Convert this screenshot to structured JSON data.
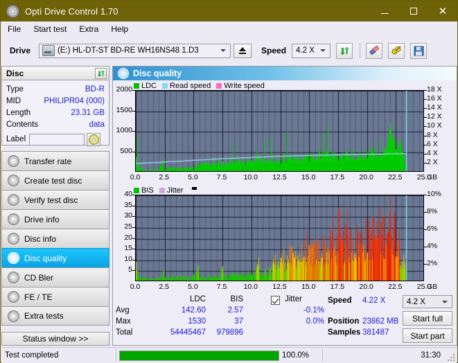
{
  "window": {
    "title": "Opti Drive Control 1.70",
    "icon": "disc-icon",
    "minimize_label": "─",
    "maximize_label": "□",
    "close_label": "✕"
  },
  "menu": {
    "items": [
      {
        "label": "File"
      },
      {
        "label": "Start test"
      },
      {
        "label": "Extra"
      },
      {
        "label": "Help"
      }
    ]
  },
  "toolbar": {
    "drive_label": "Drive",
    "drive_value": "(E:)  HL-DT-ST BD-RE  WH16NS48 1.D3",
    "eject_icon": "eject-icon",
    "speed_label": "Speed",
    "speed_value": "4.2 X",
    "refresh_icon": "refresh-icon",
    "erase_icon": "eraser-icon",
    "settings_icon": "plug-icon",
    "save_icon": "save-icon"
  },
  "disc_panel": {
    "title": "Disc",
    "refresh_icon": "refresh-icon",
    "rows": [
      {
        "key": "Type",
        "value": "BD-R"
      },
      {
        "key": "MID",
        "value": "PHILIPR04 (000)"
      },
      {
        "key": "Length",
        "value": "23.31 GB"
      },
      {
        "key": "Contents",
        "value": "data"
      }
    ],
    "label_key": "Label",
    "label_value": "",
    "label_placeholder": "",
    "label_button_icon": "disc-icon"
  },
  "sidebar": {
    "items": [
      {
        "label": "Transfer rate",
        "icon": "disc-icon",
        "active": false
      },
      {
        "label": "Create test disc",
        "icon": "disc-icon",
        "active": false
      },
      {
        "label": "Verify test disc",
        "icon": "disc-icon",
        "active": false
      },
      {
        "label": "Drive info",
        "icon": "disc-icon",
        "active": false
      },
      {
        "label": "Disc info",
        "icon": "disc-icon",
        "active": false
      },
      {
        "label": "Disc quality",
        "icon": "disc-icon",
        "active": true
      },
      {
        "label": "CD Bler",
        "icon": "disc-icon",
        "active": false
      },
      {
        "label": "FE / TE",
        "icon": "disc-icon",
        "active": false
      },
      {
        "label": "Extra tests",
        "icon": "disc-icon",
        "active": false
      }
    ],
    "status_window_label": "Status window >>"
  },
  "main": {
    "header_title": "Disc quality",
    "header_icon": "disc-quality-icon"
  },
  "chart_data": [
    {
      "type": "area",
      "name": "ldc-chart",
      "title": "",
      "xlabel": "GB",
      "ylabel": "",
      "xlim": [
        0,
        25
      ],
      "ylim": [
        0,
        2000
      ],
      "y2lim": [
        0,
        18
      ],
      "xticks": [
        "0.0",
        "2.5",
        "5.0",
        "7.5",
        "10.0",
        "12.5",
        "15.0",
        "17.5",
        "20.0",
        "22.5",
        "25.0"
      ],
      "yticks": [
        "500",
        "1000",
        "1500",
        "2000"
      ],
      "y2ticks": [
        "2 X",
        "4 X",
        "6 X",
        "8 X",
        "10 X",
        "12 X",
        "14 X",
        "16 X",
        "18 X"
      ],
      "x_unit": "GB",
      "grid": true,
      "legend_position": "top-left",
      "legend": [
        {
          "label": "LDC",
          "color": "#00c000"
        },
        {
          "label": "Read speed",
          "color": "#88d8f4"
        },
        {
          "label": "Write speed",
          "color": "#ff66cc"
        }
      ],
      "plot_bg": "#6b7894",
      "cursor_x": 23.4,
      "data_end_x": 23.4,
      "series": [
        {
          "name": "LDC",
          "color": "#00c000",
          "x": [
            0.0,
            0.15,
            0.3,
            0.5,
            0.8,
            1.0,
            1.3,
            1.6,
            2.0,
            2.3,
            2.45,
            2.6,
            3.0,
            3.2,
            3.5,
            3.8,
            4.1,
            4.4,
            4.7,
            5.0,
            5.2,
            5.4,
            5.6,
            5.8,
            6.0,
            6.3,
            6.6,
            6.9,
            7.2,
            7.5,
            7.8,
            8.1,
            8.4,
            8.7,
            9.0,
            9.3,
            9.6,
            9.9,
            10.2,
            10.5,
            10.8,
            11.1,
            11.4,
            11.7,
            12.0,
            12.3,
            12.6,
            12.9,
            13.2,
            13.5,
            13.8,
            14.1,
            14.4,
            14.7,
            15.0,
            15.3,
            15.6,
            15.9,
            16.2,
            16.5,
            16.8,
            17.1,
            17.4,
            17.7,
            18.0,
            18.3,
            18.6,
            18.9,
            19.2,
            19.5,
            19.8,
            20.1,
            20.4,
            20.7,
            21.0,
            21.3,
            21.6,
            21.9,
            22.0,
            22.1,
            22.2,
            22.4,
            22.6,
            22.8,
            23.0,
            23.2,
            23.35,
            23.4
          ],
          "values": [
            480,
            200,
            120,
            90,
            70,
            60,
            60,
            70,
            60,
            470,
            60,
            90,
            120,
            150,
            110,
            130,
            140,
            120,
            130,
            110,
            260,
            230,
            250,
            240,
            260,
            250,
            270,
            260,
            270,
            260,
            280,
            300,
            290,
            300,
            320,
            280,
            300,
            330,
            310,
            470,
            330,
            350,
            380,
            360,
            420,
            400,
            380,
            400,
            390,
            420,
            410,
            400,
            430,
            420,
            460,
            440,
            430,
            450,
            470,
            520,
            450,
            480,
            470,
            500,
            490,
            520,
            500,
            530,
            520,
            560,
            540,
            570,
            560,
            590,
            580,
            620,
            700,
            1100,
            1300,
            1000,
            900,
            860,
            820,
            760,
            700,
            500,
            200,
            0
          ]
        },
        {
          "name": "Read speed",
          "color": "#88d8f4",
          "unit": "X",
          "x": [
            0.0,
            1.0,
            2.0,
            3.0,
            4.0,
            5.0,
            6.0,
            7.0,
            8.0,
            9.0,
            10.0,
            11.0,
            12.0,
            13.0,
            14.0,
            15.0,
            16.0,
            17.0,
            18.0,
            19.0,
            20.0,
            21.0,
            22.0,
            23.0,
            23.4
          ],
          "values": [
            2.0,
            2.1,
            2.2,
            2.4,
            2.5,
            2.7,
            2.8,
            3.0,
            3.1,
            3.2,
            3.3,
            3.4,
            3.5,
            3.6,
            3.7,
            3.75,
            3.8,
            3.85,
            3.9,
            3.95,
            4.0,
            4.05,
            4.1,
            4.15,
            4.2
          ]
        },
        {
          "name": "Write speed",
          "color": "#ff66cc",
          "x": [],
          "values": []
        }
      ]
    },
    {
      "type": "area",
      "name": "bis-chart",
      "title": "",
      "xlabel": "GB",
      "ylabel": "",
      "xlim": [
        0,
        25
      ],
      "ylim": [
        0,
        40
      ],
      "y2lim": [
        0,
        10
      ],
      "xticks": [
        "0.0",
        "2.5",
        "5.0",
        "7.5",
        "10.0",
        "12.5",
        "15.0",
        "17.5",
        "20.0",
        "22.5",
        "25.0"
      ],
      "yticks": [
        "5",
        "10",
        "15",
        "20",
        "25",
        "30",
        "35",
        "40"
      ],
      "y2ticks": [
        "2%",
        "4%",
        "6%",
        "8%",
        "10%"
      ],
      "x_unit": "GB",
      "grid": true,
      "legend_position": "top-left",
      "legend": [
        {
          "label": "BIS",
          "color": "#00c000"
        },
        {
          "label": "Jitter",
          "color": "#cfa8d8"
        }
      ],
      "plot_bg": "#6b7894",
      "cursor_x": 23.4,
      "data_end_x": 23.4,
      "series": [
        {
          "name": "BIS",
          "color": "#00c000",
          "x": [
            0.0,
            0.2,
            0.4,
            0.7,
            1.0,
            1.3,
            1.6,
            1.9,
            2.2,
            2.4,
            2.7,
            3.0,
            3.3,
            3.6,
            3.9,
            4.2,
            4.5,
            4.8,
            5.1,
            5.4,
            5.5,
            5.7,
            6.0,
            6.3,
            6.6,
            6.9,
            7.2,
            7.5,
            7.6,
            7.9,
            8.2,
            8.5,
            8.8,
            9.1,
            9.4,
            9.7,
            10.0,
            10.3,
            10.6,
            10.9,
            11.2,
            11.5,
            11.8,
            12.1,
            12.4,
            12.7,
            13.0,
            13.3,
            13.6,
            13.9,
            14.2,
            14.5,
            14.8,
            15.1,
            15.4,
            15.7,
            16.0,
            16.3,
            16.6,
            16.9,
            17.2,
            17.5,
            17.8,
            18.1,
            18.4,
            18.7,
            19.0,
            19.3,
            19.6,
            19.9,
            20.2,
            20.5,
            20.8,
            21.1,
            21.4,
            21.7,
            21.9,
            22.1,
            22.3,
            22.5,
            22.7,
            22.9,
            23.1,
            23.3,
            23.4
          ],
          "values": [
            9,
            3,
            2,
            2,
            2,
            2,
            2,
            2,
            2,
            7,
            2,
            3,
            3,
            3,
            3,
            3,
            3,
            3,
            3,
            8,
            3,
            3,
            3,
            3,
            3,
            3,
            3,
            8,
            3,
            3,
            3,
            4,
            4,
            4,
            4,
            4,
            4,
            5,
            11,
            5,
            5,
            6,
            8,
            12,
            10,
            14,
            12,
            15,
            13,
            16,
            14,
            17,
            15,
            18,
            16,
            19,
            17,
            20,
            18,
            21,
            19,
            22,
            20,
            23,
            21,
            24,
            22,
            25,
            23,
            26,
            24,
            28,
            26,
            30,
            28,
            32,
            34,
            36,
            32,
            30,
            26,
            20,
            12,
            6,
            2
          ]
        },
        {
          "name": "Jitter",
          "color": "#cfa8d8",
          "unit": "%",
          "x": [],
          "values": []
        }
      ]
    }
  ],
  "stats": {
    "col_headers": [
      "LDC",
      "BIS"
    ],
    "jitter_label": "Jitter",
    "jitter_checked": true,
    "rows": [
      {
        "label": "Avg",
        "ldc": "142.60",
        "bis": "2.57",
        "jitter": "-0.1%"
      },
      {
        "label": "Max",
        "ldc": "1530",
        "bis": "37",
        "jitter": "0.0%"
      },
      {
        "label": "Total",
        "ldc": "54445467",
        "bis": "979896",
        "jitter": ""
      }
    ],
    "speed_label": "Speed",
    "speed_value": "4.22 X",
    "position_label": "Position",
    "position_value": "23862 MB",
    "samples_label": "Samples",
    "samples_value": "381487",
    "speed_select_value": "4.2 X",
    "start_full_label": "Start full",
    "start_part_label": "Start part"
  },
  "statusbar": {
    "message": "Test completed",
    "progress_percent": 100,
    "progress_label": "100.0%",
    "elapsed": "31:30"
  }
}
